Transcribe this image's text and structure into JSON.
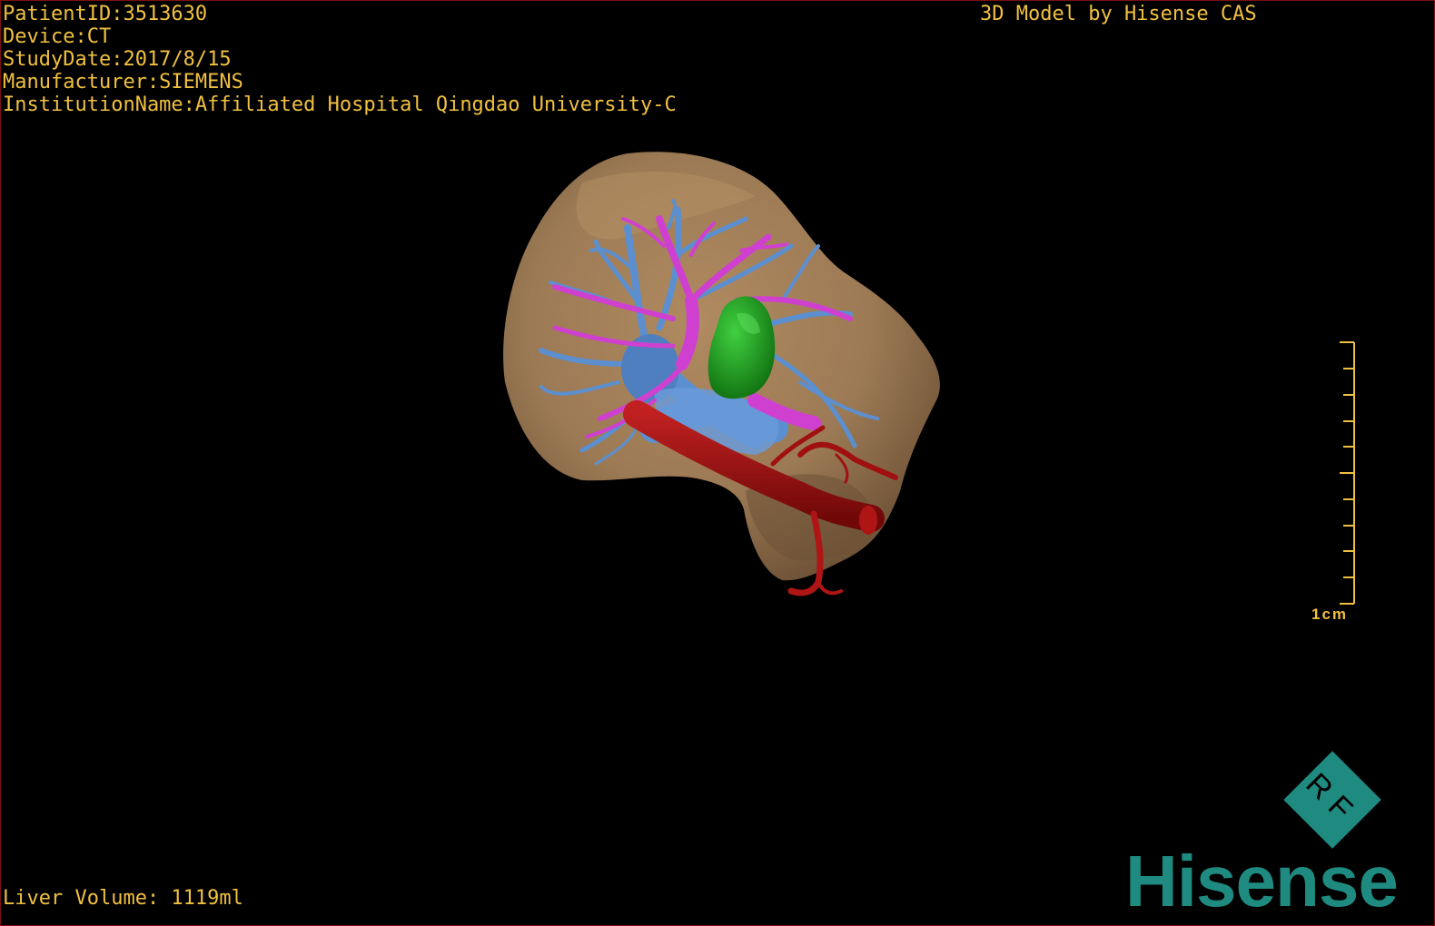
{
  "overlay": {
    "patient_line": "PatientID:3513630",
    "device_line": "Device:CT",
    "study_date_line": "StudyDate:2017/8/15",
    "manufacturer_line": "Manufacturer:SIEMENS",
    "institution_line": "InstitutionName:Affiliated Hospital Qingdao University-C",
    "model_credit": "3D Model by Hisense CAS",
    "liver_volume_line": "Liver Volume: 1119ml",
    "scale_bar_label": "1cm"
  },
  "logo": {
    "brand_text": "Hisense",
    "badge_text": "RF"
  },
  "colors": {
    "overlay_text": "#f0c040",
    "liver": "#9c7a55",
    "portal_vein": "#5b8fd0",
    "hepatic_vein": "#d040d0",
    "artery": "#a01010",
    "tumor": "#20a020",
    "brand": "#1f8a80",
    "viewport_border": "#7a1010"
  }
}
